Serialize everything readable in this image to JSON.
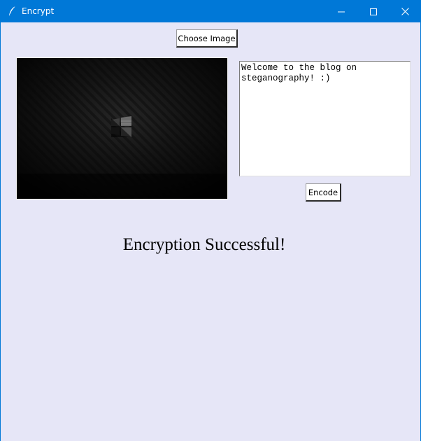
{
  "window": {
    "title": "Encrypt",
    "icons": {
      "app": "feather-icon",
      "minimize": "minimize-icon",
      "maximize": "maximize-icon",
      "close": "close-icon"
    }
  },
  "toolbar": {
    "choose_label": "Choose Image"
  },
  "message": {
    "text": "Welcome to the blog on\nsteganography! :)"
  },
  "actions": {
    "encode_label": "Encode"
  },
  "status": {
    "text": "Encryption Successful!"
  },
  "colors": {
    "titlebar": "#0078d7",
    "background": "#e6e6f7",
    "image_background": "#050505"
  }
}
